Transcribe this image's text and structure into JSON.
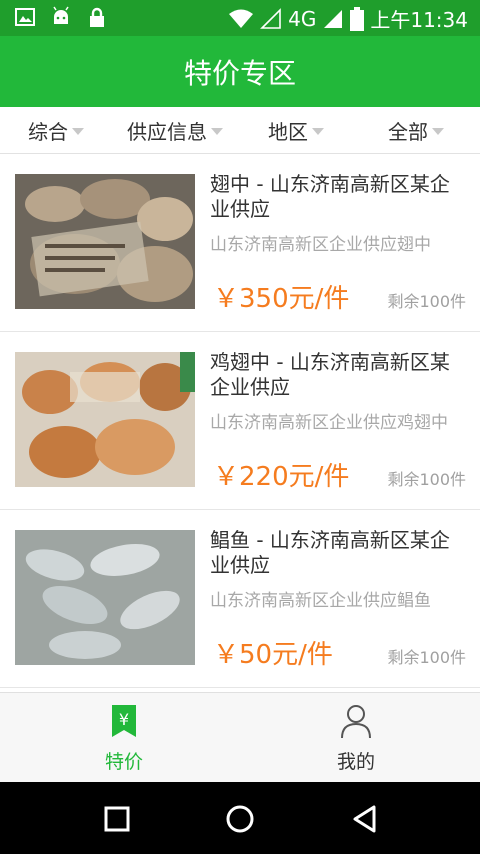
{
  "status_bar": {
    "network": "4G",
    "time": "上午11:34",
    "left_icons": [
      "image-icon",
      "android-icon",
      "lock-icon"
    ],
    "right_icons": [
      "wifi-icon",
      "signal-icon",
      "battery-icon"
    ]
  },
  "header": {
    "title": "特价专区"
  },
  "filters": [
    {
      "label": "综合"
    },
    {
      "label": "供应信息"
    },
    {
      "label": "地区"
    },
    {
      "label": "全部"
    }
  ],
  "items": [
    {
      "title": "翅中 - 山东济南高新区某企业供应",
      "desc": "山东济南高新区企业供应翅中",
      "price": "￥350元/件",
      "stock": "剩余100件"
    },
    {
      "title": "鸡翅中 - 山东济南高新区某企业供应",
      "desc": "山东济南高新区企业供应鸡翅中",
      "price": "￥220元/件",
      "stock": "剩余100件"
    },
    {
      "title": "鲳鱼 - 山东济南高新区某企业供应",
      "desc": "山东济南高新区企业供应鲳鱼",
      "price": "￥50元/件",
      "stock": "剩余100件"
    }
  ],
  "tabs": [
    {
      "label": "特价",
      "icon": "yen-tag-icon",
      "active": true
    },
    {
      "label": "我的",
      "icon": "person-icon",
      "active": false
    }
  ],
  "colors": {
    "accent": "#22b83a",
    "status_bar": "#1f9e2c",
    "price": "#f57c1f",
    "muted": "#a8a8a8"
  }
}
